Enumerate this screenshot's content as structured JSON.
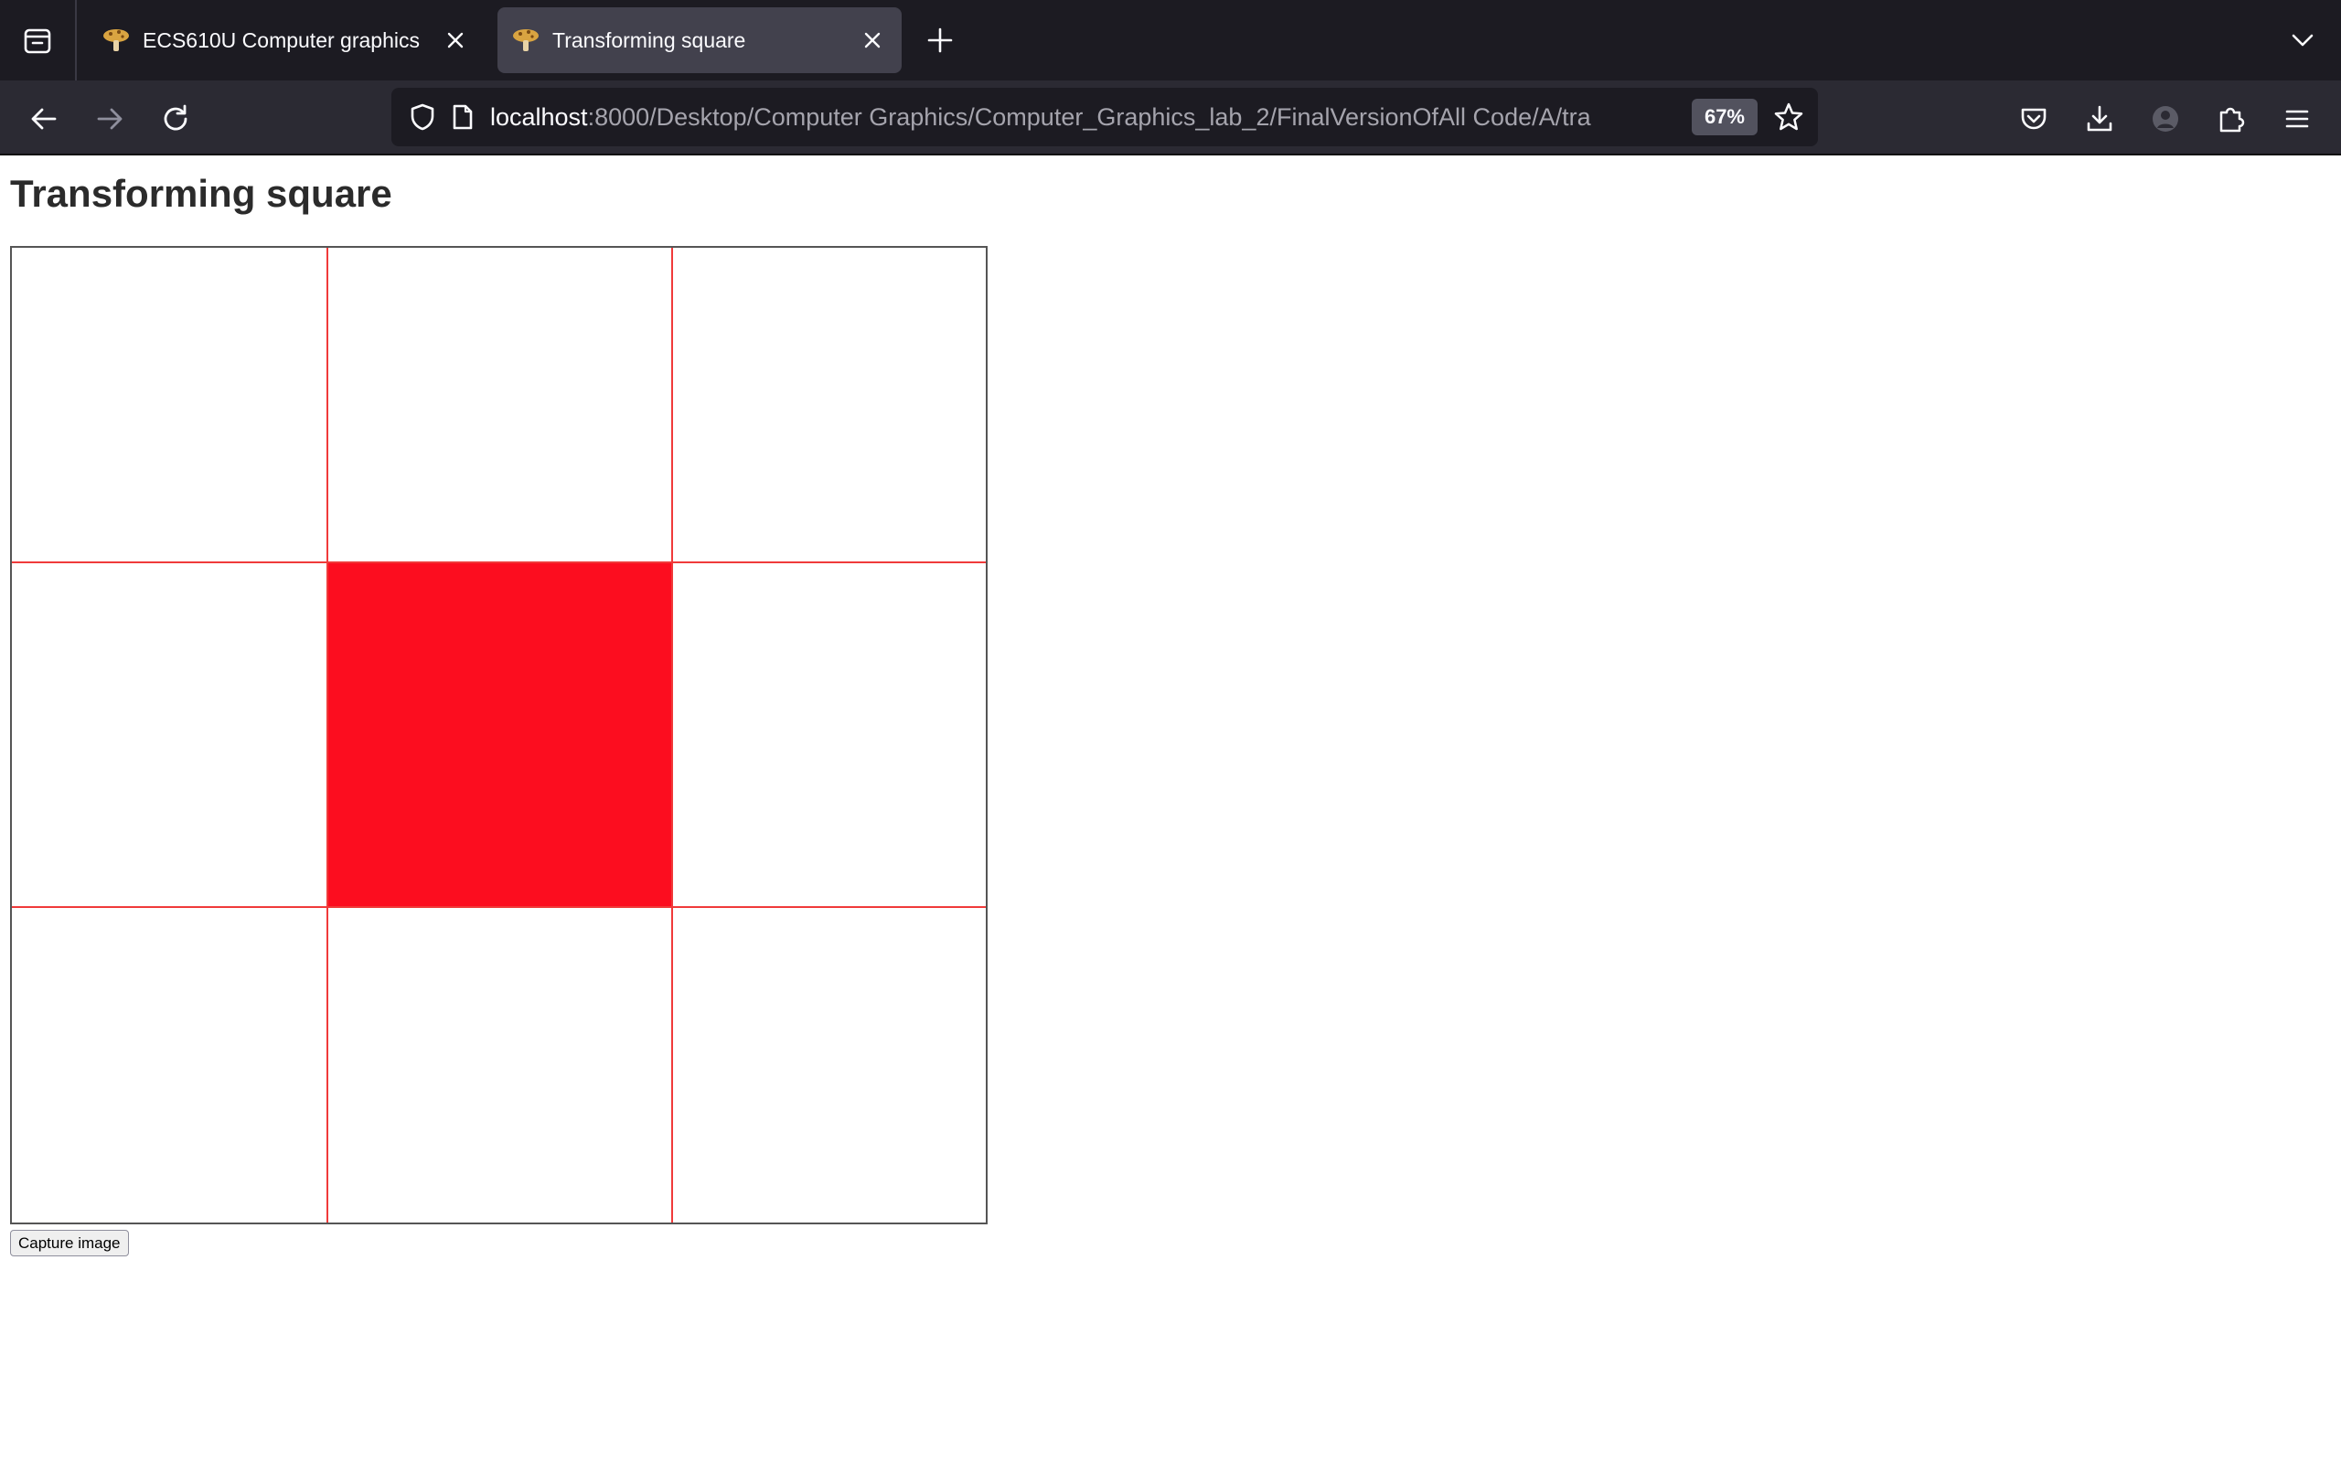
{
  "browser": {
    "tabs": [
      {
        "title": "ECS610U Computer graphics",
        "active": false,
        "favicon": "mushroom-favicon"
      },
      {
        "title": "Transforming square",
        "active": true,
        "favicon": "mushroom-favicon"
      }
    ],
    "url": {
      "host": "localhost",
      "rest": ":8000/Desktop/Computer Graphics/Computer_Graphics_lab_2/FinalVersionOfAll Code/A/tra"
    },
    "zoom": "67%",
    "icons": {
      "overview": "tab-overview-icon",
      "back": "back-arrow-icon",
      "forward": "forward-arrow-icon",
      "reload": "reload-icon",
      "shield": "tracking-protection-shield-icon",
      "page": "page-icon",
      "bookmark": "star-icon",
      "pocket": "pocket-icon",
      "downloads": "download-icon",
      "account": "account-icon",
      "extensions": "extensions-puzzle-icon",
      "menu": "hamburger-menu-icon"
    }
  },
  "page": {
    "title": "Transforming square",
    "capture_button": "Capture image",
    "canvas": {
      "grid_color": "#f03a3a",
      "square_color": "#fc0d1f",
      "filled_cell": "center"
    }
  }
}
